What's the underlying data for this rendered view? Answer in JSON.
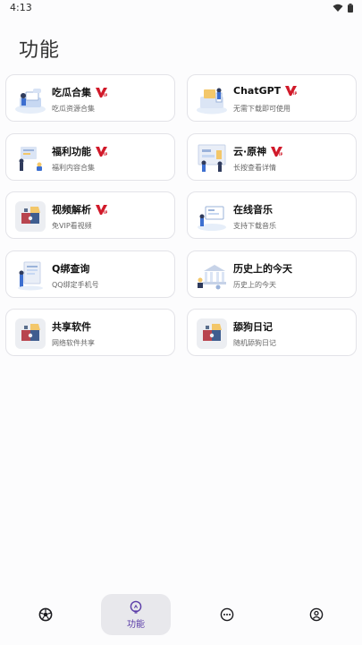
{
  "status_bar": {
    "time": "4:13"
  },
  "page": {
    "title": "功能"
  },
  "cards": [
    {
      "title": "吃瓜合集",
      "subtitle": "吃瓜资源合集",
      "vip": true,
      "icon": "desk-illustration-icon"
    },
    {
      "title": "ChatGPT",
      "subtitle": "无需下载即可使用",
      "vip": true,
      "icon": "office-illustration-icon"
    },
    {
      "title": "福利功能",
      "subtitle": "福利内容合集",
      "vip": true,
      "icon": "meeting-illustration-icon"
    },
    {
      "title": "云·原神",
      "subtitle": "长按查看详情",
      "vip": true,
      "icon": "board-illustration-icon"
    },
    {
      "title": "视频解析",
      "subtitle": "免VIP看视频",
      "vip": true,
      "icon": "puzzle-icon"
    },
    {
      "title": "在线音乐",
      "subtitle": "支持下载音乐",
      "vip": false,
      "icon": "presentation-illustration-icon"
    },
    {
      "title": "Q绑查询",
      "subtitle": "QQ绑定手机号",
      "vip": false,
      "icon": "document-illustration-icon"
    },
    {
      "title": "历史上的今天",
      "subtitle": "历史上的今天",
      "vip": false,
      "icon": "bank-illustration-icon"
    },
    {
      "title": "共享软件",
      "subtitle": "网络软件共享",
      "vip": false,
      "icon": "puzzle-icon"
    },
    {
      "title": "舔狗日记",
      "subtitle": "随机舔狗日记",
      "vip": false,
      "icon": "puzzle-icon"
    }
  ],
  "bottom_nav": [
    {
      "icon": "soccer-ball-icon",
      "label": ""
    },
    {
      "icon": "lightbulb-icon",
      "label": "功能",
      "active": true
    },
    {
      "icon": "more-dots-icon",
      "label": ""
    },
    {
      "icon": "profile-icon",
      "label": ""
    }
  ],
  "colors": {
    "accent": "#5b3da8",
    "vip_red": "#d11a2a",
    "card_border": "#e3e3e8"
  }
}
